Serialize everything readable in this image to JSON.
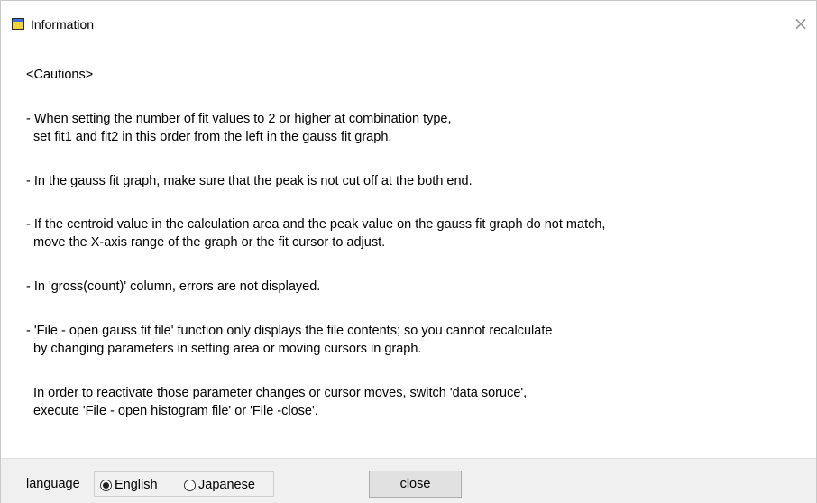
{
  "window": {
    "title": "Information",
    "close_glyph": "×"
  },
  "content": {
    "lines": [
      "<Cautions>",
      "- When setting the number of fit values to 2 or higher at combination type,",
      "  set fit1 and fit2 in this order from the left in the gauss fit graph.",
      "- In the gauss fit graph, make sure that the peak is not cut off at the both end.",
      "- If the centroid value in the calculation area and the peak value on the gauss fit graph do not match,",
      "  move the X-axis range of the graph or the fit cursor to adjust.",
      "- In 'gross(count)' column, errors are not displayed.",
      "- 'File - open gauss fit file' function only displays the file contents; so you cannot recalculate",
      "  by changing parameters in setting area or moving cursors in graph.",
      "  In order to reactivate those parameter changes or cursor moves, switch 'data soruce',",
      "  execute 'File - open histogram file' or 'File -close'."
    ]
  },
  "footer": {
    "language_label": "language",
    "options": [
      {
        "label": "English",
        "selected": true
      },
      {
        "label": "Japanese",
        "selected": false
      }
    ],
    "close_label": "close"
  }
}
